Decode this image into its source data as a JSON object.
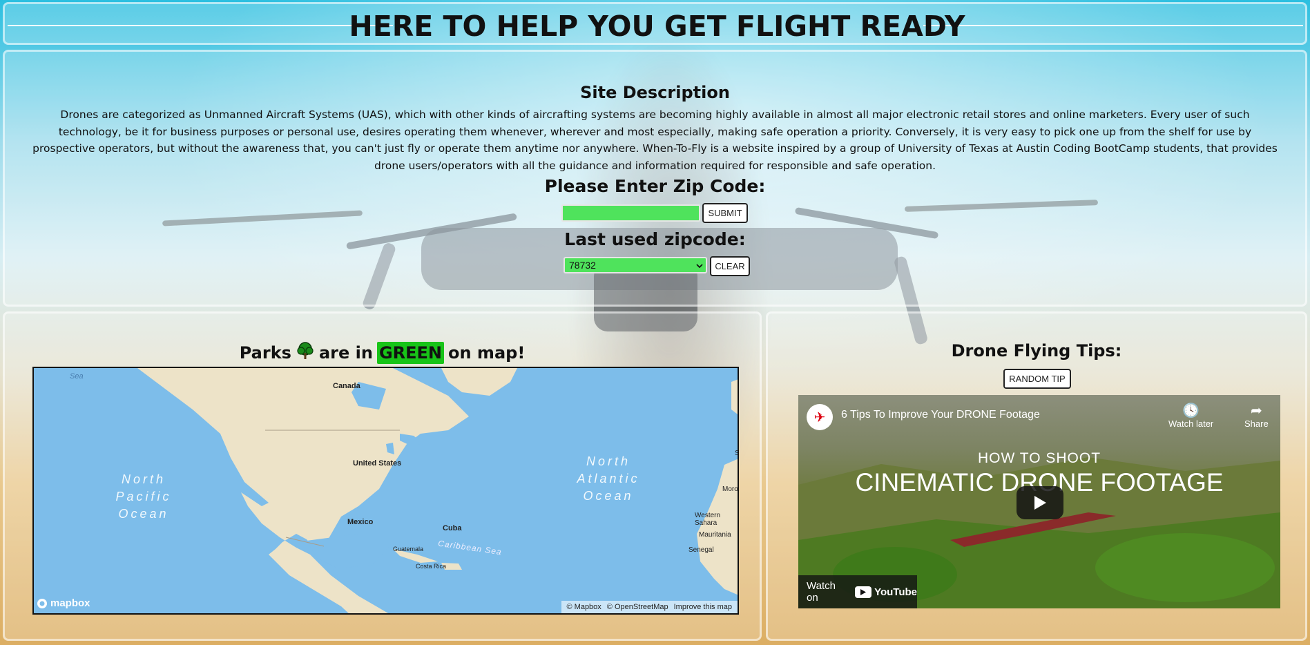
{
  "header": {
    "title": "HERE TO HELP YOU GET FLIGHT READY"
  },
  "description": {
    "heading": "Site Description",
    "text": "Drones are categorized as Unmanned Aircraft Systems (UAS), which with other kinds of aircrafting systems are becoming highly available in almost all major electronic retail stores and online marketers. Every user of such technology, be it for business purposes or personal use, desires operating them whenever, wherever and most especially, making safe operation a priority. Conversely, it is very easy to pick one up from the shelf for use by prospective operators, but without the awareness that, you can't just fly or operate them anytime nor anywhere. When-To-Fly is a website inspired by a group of University of Texas at Austin Coding BootCamp students, that provides drone users/operators with all the guidance and information required for responsible and safe operation."
  },
  "zip": {
    "heading": "Please Enter Zip Code:",
    "input_value": "",
    "submit_label": "SUBMIT",
    "last_heading": "Last used zipcode:",
    "last_selected": "78732",
    "clear_label": "CLEAR"
  },
  "map_section": {
    "heading_prefix": "Parks",
    "heading_icon": "tree-icon",
    "heading_mid": "are in",
    "heading_highlight": "GREEN",
    "heading_suffix": "on map!",
    "labels": {
      "sea": "Sea",
      "canada": "Canada",
      "united_states": "United States",
      "mexico": "Mexico",
      "cuba": "Cuba",
      "guatemala": "Guatemala",
      "costa_rica": "Costa Rica",
      "caribbean_sea": "Caribbean Sea",
      "north_pacific": "North Pacific Ocean",
      "north_atlantic": "North Atlantic Ocean",
      "western_sahara": "Western Sahara",
      "mauritania": "Mauritania",
      "senegal": "Senegal",
      "morocco_partial": "Moro",
      "s_partial": "S"
    },
    "logo": "mapbox",
    "attribution": [
      "© Mapbox",
      "© OpenStreetMap",
      "Improve this map"
    ],
    "colors": {
      "land": "#ede3c8",
      "water": "#7dbdea"
    }
  },
  "tips": {
    "heading": "Drone Flying Tips:",
    "random_label": "RANDOM TIP",
    "video": {
      "title": "6 Tips To Improve Your DRONE Footage",
      "watch_later": "Watch later",
      "share": "Share",
      "overlay_line1": "HOW TO SHOOT",
      "overlay_line2": "CINEMATIC DRONE FOOTAGE",
      "watch_on": "Watch on",
      "youtube": "YouTube"
    }
  },
  "colors": {
    "accent_green": "#4fe35c",
    "highlight_green": "#18c418"
  }
}
